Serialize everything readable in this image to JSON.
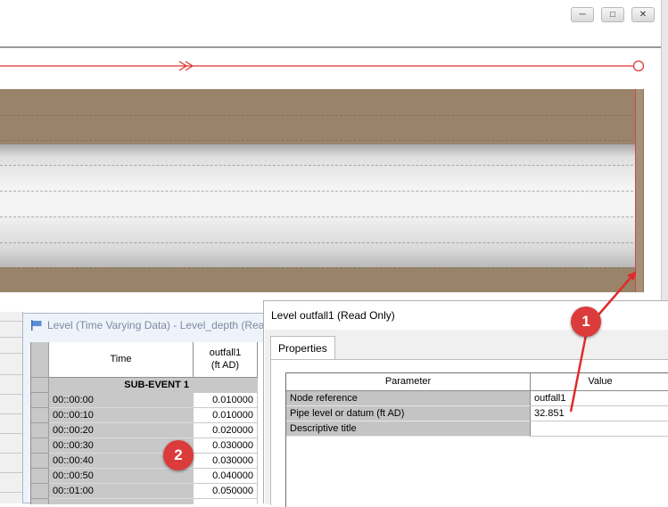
{
  "tvd_window": {
    "title": "Level (Time Varying Data) - Level_depth (Read",
    "col_time": "Time",
    "col_series": "outfall1\n(ft AD)",
    "sub_event": "SUB-EVENT 1",
    "rows": [
      {
        "time": "00::00:00",
        "value": "0.010000"
      },
      {
        "time": "00::00:10",
        "value": "0.010000"
      },
      {
        "time": "00::00:20",
        "value": "0.020000"
      },
      {
        "time": "00::00:30",
        "value": "0.030000"
      },
      {
        "time": "00::00:40",
        "value": "0.030000"
      },
      {
        "time": "00::00:50",
        "value": "0.040000"
      },
      {
        "time": "00::01:00",
        "value": "0.050000"
      }
    ]
  },
  "props_window": {
    "title": "Level outfall1 (Read Only)",
    "tab": "Properties",
    "col_parameter": "Parameter",
    "col_value": "Value",
    "params": [
      {
        "name": "Node reference",
        "value": "outfall1"
      },
      {
        "name": "Pipe level or datum (ft AD)",
        "value": "32.851"
      },
      {
        "name": "Descriptive title",
        "value": ""
      }
    ]
  },
  "callouts": {
    "one": "1",
    "two": "2"
  },
  "colors": {
    "ground": "#9a8469",
    "flow_line": "#e03030",
    "callout": "#dc3b3b",
    "grid_header": "#c8c8c8"
  },
  "icons": {
    "window_minimize": "minimize-icon",
    "window_maximize": "maximize-icon",
    "window_close": "close-icon",
    "tvd_window": "flag-icon"
  }
}
